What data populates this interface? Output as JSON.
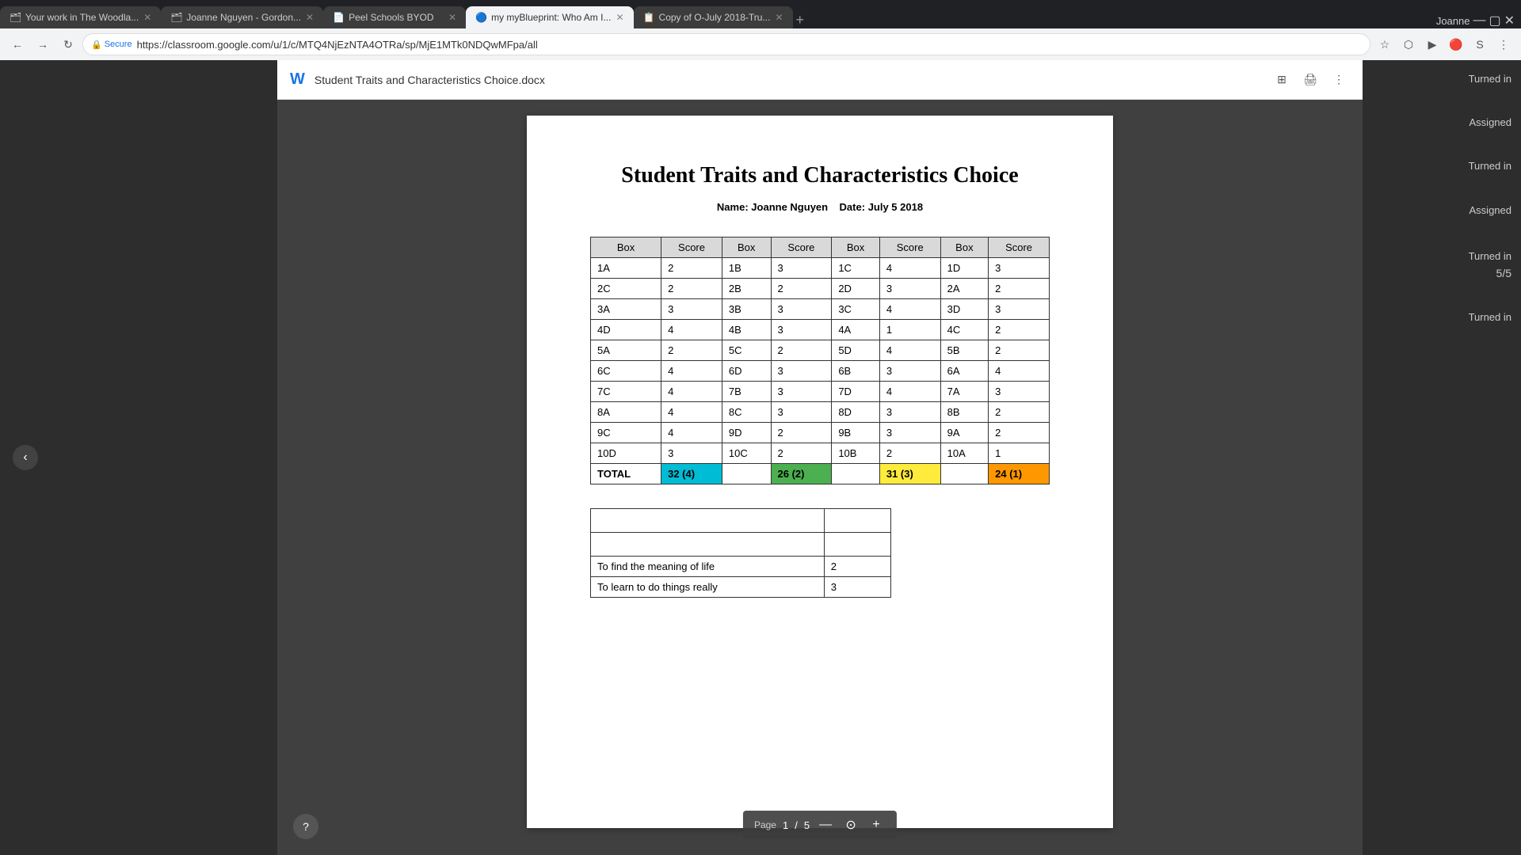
{
  "browser": {
    "tabs": [
      {
        "id": "tab1",
        "title": "Your work in The Woodla...",
        "favicon": "🗂",
        "active": false
      },
      {
        "id": "tab2",
        "title": "Joanne Nguyen - Gordon...",
        "favicon": "🗂",
        "active": false
      },
      {
        "id": "tab3",
        "title": "Peel Schools BYOD",
        "favicon": "📄",
        "active": false
      },
      {
        "id": "tab4",
        "title": "my myBlueprint: Who Am I...",
        "favicon": "🔵",
        "active": true
      },
      {
        "id": "tab5",
        "title": "Copy of O-July 2018-Tru...",
        "favicon": "📋",
        "active": false
      }
    ],
    "url": "https://classroom.google.com/u/1/c/MTQ4NjEzNTA4OTRa/sp/MjE1MTk0NDQwMFpa/all",
    "secure_label": "Secure",
    "user": "Joanne"
  },
  "doc_toolbar": {
    "w_icon": "W",
    "title": "Student Traits and Characteristics Choice.docx"
  },
  "page": {
    "title": "Student Traits and Characteristics Choice",
    "name_label": "Name:",
    "name_value": "Joanne Nguyen",
    "date_label": "Date:",
    "date_value": "July 5 2018"
  },
  "table": {
    "headers": [
      "Box",
      "Score",
      "Box",
      "Score",
      "Box",
      "Score",
      "Box",
      "Score"
    ],
    "rows": [
      [
        "1A",
        "2",
        "1B",
        "3",
        "1C",
        "4",
        "1D",
        "3"
      ],
      [
        "2C",
        "2",
        "2B",
        "2",
        "2D",
        "3",
        "2A",
        "2"
      ],
      [
        "3A",
        "3",
        "3B",
        "3",
        "3C",
        "4",
        "3D",
        "3"
      ],
      [
        "4D",
        "4",
        "4B",
        "3",
        "4A",
        "1",
        "4C",
        "2"
      ],
      [
        "5A",
        "2",
        "5C",
        "2",
        "5D",
        "4",
        "5B",
        "2"
      ],
      [
        "6C",
        "4",
        "6D",
        "3",
        "6B",
        "3",
        "6A",
        "4"
      ],
      [
        "7C",
        "4",
        "7B",
        "3",
        "7D",
        "4",
        "7A",
        "3"
      ],
      [
        "8A",
        "4",
        "8C",
        "3",
        "8D",
        "3",
        "8B",
        "2"
      ],
      [
        "9C",
        "4",
        "9D",
        "2",
        "9B",
        "3",
        "9A",
        "2"
      ],
      [
        "10D",
        "3",
        "10C",
        "2",
        "10B",
        "2",
        "10A",
        "1"
      ]
    ],
    "total_row": {
      "label": "TOTAL",
      "totals": [
        {
          "value": "32 (4)",
          "style": "cyan"
        },
        {
          "value": "26 (2)",
          "style": "green"
        },
        {
          "value": "31 (3)",
          "style": "yellow"
        },
        {
          "value": "24 (1)",
          "style": "orange"
        }
      ]
    }
  },
  "second_table": {
    "rows": [
      {
        "text": "",
        "value": ""
      },
      {
        "text": "",
        "value": ""
      },
      {
        "text": "To find the meaning of life",
        "value": "2"
      },
      {
        "text": "To learn to do things really",
        "value": "3"
      }
    ]
  },
  "right_sidebar": {
    "labels": [
      "Turned in",
      "Assigned",
      "Turned in",
      "Assigned",
      "Turned in",
      "Turned in"
    ],
    "score": "5/5"
  },
  "page_nav": {
    "label": "Page",
    "current": "1",
    "separator": "/",
    "total": "5"
  }
}
